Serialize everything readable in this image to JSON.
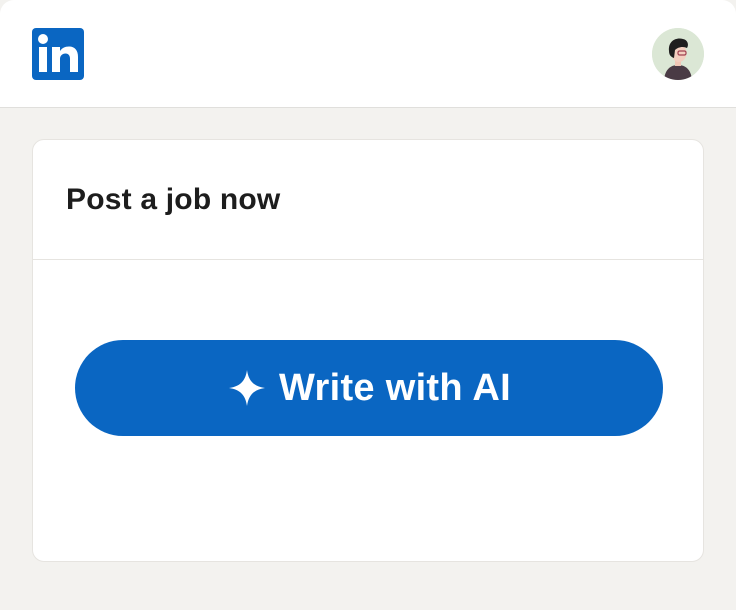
{
  "header": {
    "logo_icon": "linkedin-logo-icon",
    "avatar_icon": "user-avatar-icon"
  },
  "card": {
    "title": "Post a job now",
    "cta_label": "Write with AI",
    "cta_icon": "sparkle-icon"
  },
  "colors": {
    "brand": "#0a66c2",
    "background": "#f3f2ef",
    "card": "#ffffff"
  }
}
